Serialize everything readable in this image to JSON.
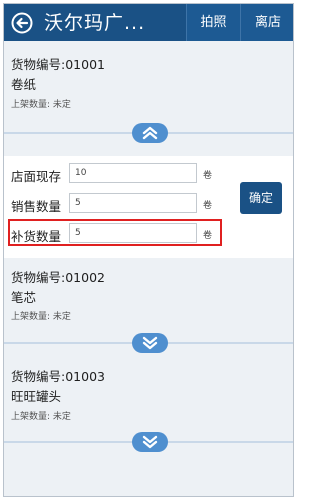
{
  "header": {
    "title": "沃尔玛广...",
    "photo_label": "拍照",
    "leave_label": "离店"
  },
  "items": [
    {
      "code": "货物编号:01001",
      "name": "卷纸",
      "shelf_qty": "上架数量: 未定",
      "expanded": true
    },
    {
      "code": "货物编号:01002",
      "name": "笔芯",
      "shelf_qty": "上架数量: 未定",
      "expanded": false
    },
    {
      "code": "货物编号:01003",
      "name": "旺旺罐头",
      "shelf_qty": "上架数量: 未定",
      "expanded": false
    }
  ],
  "form": {
    "store_stock_label": "店面现存",
    "store_stock_value": "10",
    "sales_label": "销售数量",
    "sales_value": "5",
    "restock_label": "补货数量",
    "restock_value": "5",
    "unit": "卷",
    "confirm_label": "确定"
  },
  "colors": {
    "header": "#1a5185",
    "toggle": "#4f8fcf",
    "highlight": "#e02020"
  }
}
